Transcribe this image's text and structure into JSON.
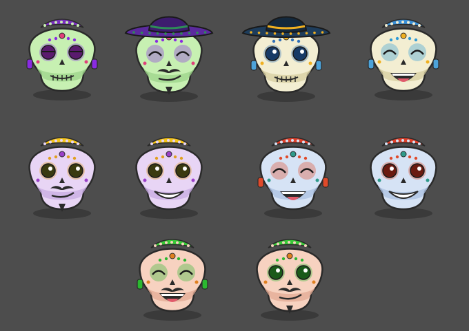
{
  "sprite_sheet": {
    "background": "#4d4d4d",
    "skulls": [
      {
        "id": "skull-1",
        "skull": "#c7f0b2",
        "shade": "#9fd68c",
        "deco": "#8a2be2",
        "deco2": "#e0407a",
        "headband": "#7b2fbe",
        "eyes": "closed-sad",
        "eye_color": "#5a1a6e",
        "mouth": "stitched",
        "earring": "#8a2be2",
        "hat": null,
        "mustache": false,
        "beard": false
      },
      {
        "id": "skull-2",
        "skull": "#c7f0b2",
        "shade": "#9fd68c",
        "deco": "#8a2be2",
        "deco2": "#e0407a",
        "headband": null,
        "eyes": "happy-closed",
        "eye_color": "#5a1a6e",
        "mouth": "smirk",
        "earring": null,
        "hat": {
          "brim": "#5b2a9e",
          "crown": "#3d1c6e",
          "band": "#2e8b57"
        },
        "mustache": true,
        "beard": true
      },
      {
        "id": "skull-3",
        "skull": "#f3eed2",
        "shade": "#d8cfa3",
        "deco": "#2f6fb8",
        "deco2": "#f0b020",
        "headband": null,
        "eyes": "open-round",
        "eye_color": "#173a66",
        "mouth": "stitched",
        "earring": "#4da3d9",
        "hat": {
          "brim": "#1e3d5c",
          "crown": "#14293d",
          "band": "#f0b020"
        },
        "mustache": false,
        "beard": false
      },
      {
        "id": "skull-4",
        "skull": "#f3eed2",
        "shade": "#d8cfa3",
        "deco": "#2f9ad6",
        "deco2": "#f0b020",
        "headband": "#3a8fd6",
        "eyes": "happy-closed",
        "eye_color": "#1a4a7a",
        "mouth": "laugh",
        "earring": "#4da3d9",
        "hat": null,
        "mustache": false,
        "beard": false
      },
      {
        "id": "skull-5",
        "skull": "#e8d5f5",
        "shade": "#c9aee3",
        "deco": "#e0a020",
        "deco2": "#9a40c8",
        "headband": "#f5c518",
        "eyes": "open-round",
        "eye_color": "#3a3a10",
        "mouth": "smirk",
        "earring": null,
        "hat": null,
        "mustache": true,
        "beard": true
      },
      {
        "id": "skull-6",
        "skull": "#e8d5f5",
        "shade": "#c9aee3",
        "deco": "#e0a020",
        "deco2": "#9a40c8",
        "headband": "#f5c518",
        "eyes": "open-round",
        "eye_color": "#3a3a10",
        "mouth": "grin",
        "earring": null,
        "hat": null,
        "mustache": false,
        "beard": false
      },
      {
        "id": "skull-7",
        "skull": "#d6e3f5",
        "shade": "#aec3e3",
        "deco": "#e04a2a",
        "deco2": "#2e9a8a",
        "headband": "#e0402a",
        "eyes": "happy-closed",
        "eye_color": "#6a1a10",
        "mouth": "laugh",
        "earring": "#e04a2a",
        "hat": null,
        "mustache": false,
        "beard": false
      },
      {
        "id": "skull-8",
        "skull": "#d6e3f5",
        "shade": "#aec3e3",
        "deco": "#e04a2a",
        "deco2": "#2e9a8a",
        "headband": "#e0402a",
        "eyes": "open-round",
        "eye_color": "#6a1a10",
        "mouth": "grin",
        "earring": null,
        "hat": null,
        "mustache": false,
        "beard": false
      },
      {
        "id": "skull-9",
        "skull": "#f7d2c0",
        "shade": "#e3ac96",
        "deco": "#2bb830",
        "deco2": "#e08020",
        "headband": "#38c838",
        "eyes": "happy-closed",
        "eye_color": "#1a5a1a",
        "mouth": "laugh",
        "earring": "#2bb830",
        "hat": null,
        "mustache": true,
        "beard": false
      },
      {
        "id": "skull-10",
        "skull": "#f7d2c0",
        "shade": "#e3ac96",
        "deco": "#2bb830",
        "deco2": "#e08020",
        "headband": "#38c838",
        "eyes": "open-round",
        "eye_color": "#1a5a1a",
        "mouth": "smirk",
        "earring": null,
        "hat": null,
        "mustache": true,
        "beard": true
      }
    ]
  }
}
